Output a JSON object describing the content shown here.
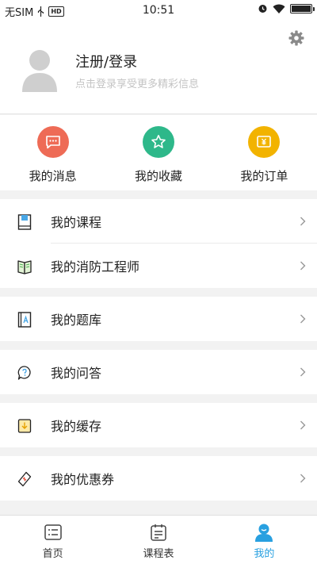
{
  "status_bar": {
    "carrier": "无SIM",
    "badge": "HD",
    "time": "10:51"
  },
  "profile": {
    "title": "注册/登录",
    "subtitle": "点击登录享受更多精彩信息"
  },
  "quick_actions": [
    {
      "label": "我的消息",
      "icon": "message-icon",
      "color": "#ee6b56"
    },
    {
      "label": "我的收藏",
      "icon": "star-icon",
      "color": "#2eb88a"
    },
    {
      "label": "我的订单",
      "icon": "order-icon",
      "color": "#f2b300"
    }
  ],
  "menu": {
    "courses": "我的课程",
    "fire_engineer": "我的消防工程师",
    "question_bank": "我的题库",
    "qa": "我的问答",
    "cache": "我的缓存",
    "coupons": "我的优惠券"
  },
  "tabbar": [
    {
      "label": "首页",
      "icon": "home-list-icon"
    },
    {
      "label": "课程表",
      "icon": "schedule-icon"
    },
    {
      "label": "我的",
      "icon": "user-icon"
    }
  ],
  "colors": {
    "accent": "#28a0e0",
    "muted_text": "#c4c4c4"
  }
}
